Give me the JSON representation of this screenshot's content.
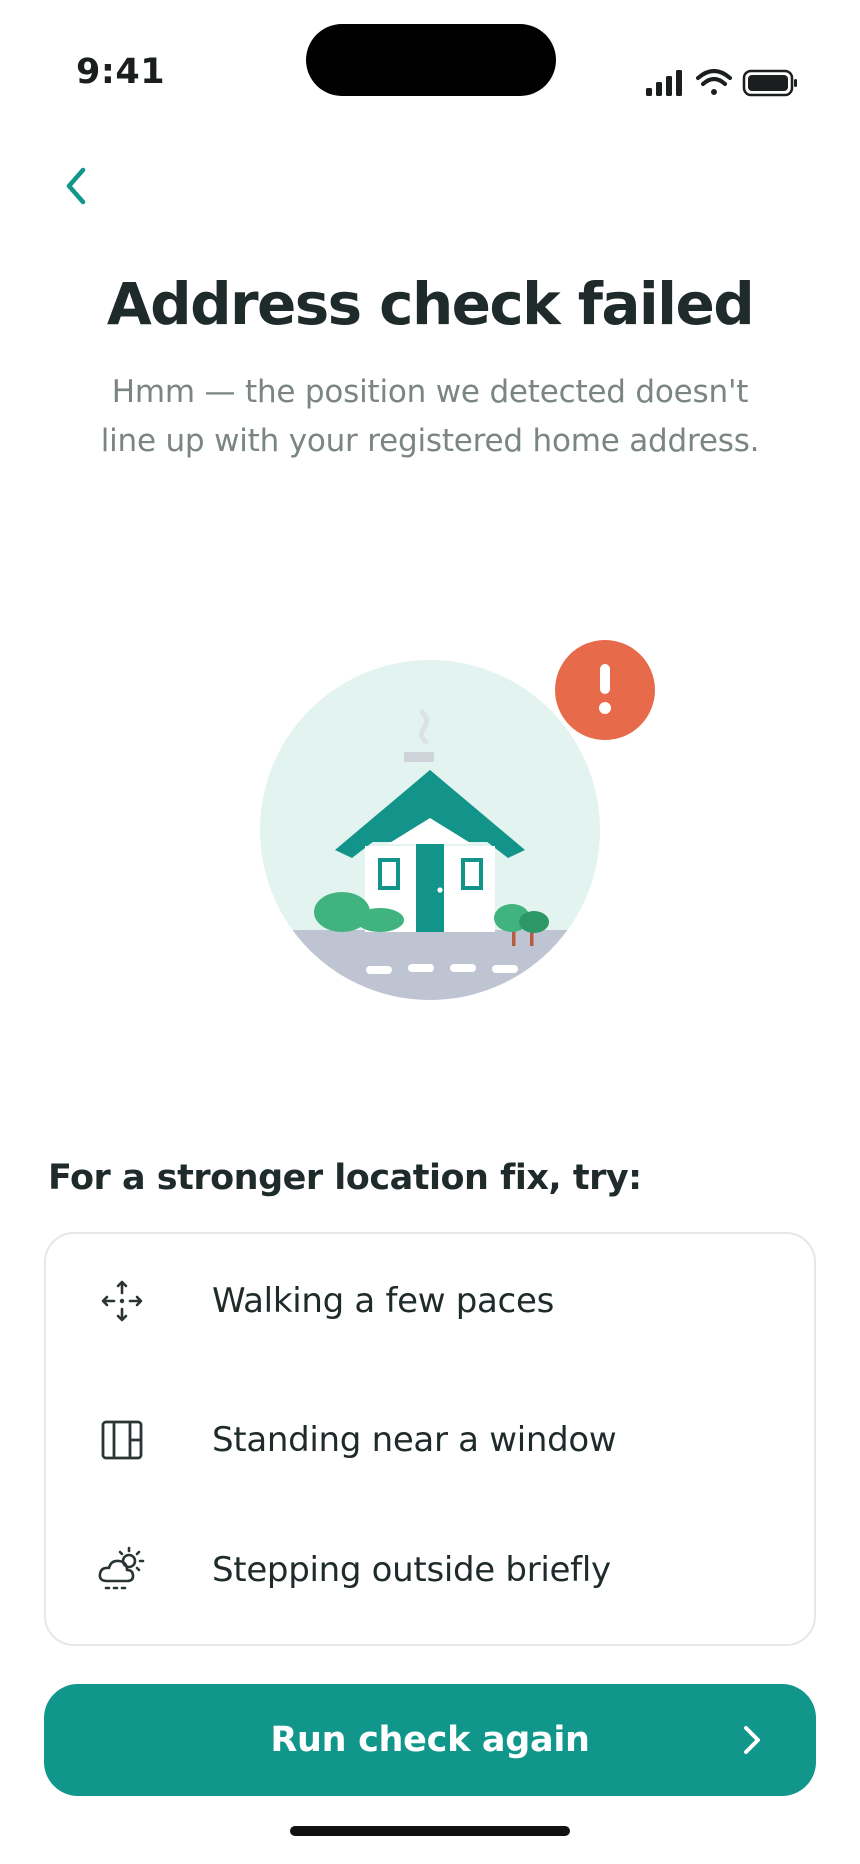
{
  "status_bar": {
    "time": "9:41",
    "icons": [
      "cellular-signal-icon",
      "wifi-icon",
      "battery-icon"
    ]
  },
  "nav": {
    "back_icon": "chevron-left-icon"
  },
  "header": {
    "title": "Address check failed",
    "subtitle": "Hmm — the position we detected doesn't line up with your registered home address."
  },
  "illustration": {
    "subject": "house-icon",
    "badge_icon": "exclamation-icon",
    "badge_text": "!"
  },
  "tips": {
    "heading": "For a stronger location fix, try:",
    "items": [
      {
        "icon": "move-arrows-icon",
        "label": "Walking a few paces"
      },
      {
        "icon": "window-icon",
        "label": "Standing near a window"
      },
      {
        "icon": "partly-cloudy-icon",
        "label": "Stepping outside briefly"
      }
    ]
  },
  "primary_action": {
    "label": "Run check again",
    "icon": "chevron-right-icon"
  },
  "colors": {
    "accent": "#10968a",
    "alert": "#e76a4a",
    "title": "#1f2a2a",
    "muted": "#7a8584"
  }
}
